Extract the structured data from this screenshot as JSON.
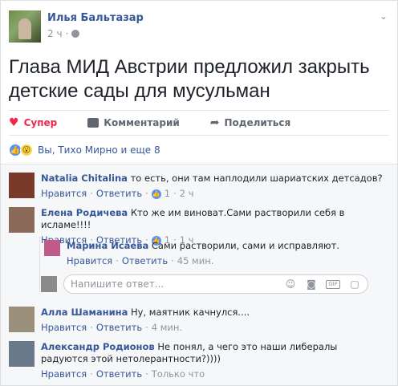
{
  "post": {
    "author": "Илья Бальтазар",
    "time": "2 ч",
    "text": "Глава МИД Австрии предложил закрыть детские сады для мусульман",
    "actions": {
      "react": "Супер",
      "comment": "Комментарий",
      "share": "Поделиться"
    },
    "reactions_text": "Вы, Тихо Мирно и еще 8"
  },
  "comments": [
    {
      "name": "Natalia Chitalina",
      "text": "то есть, они там наплодили шариатских детсадов?",
      "like": "Нравится",
      "reply": "Ответить",
      "likes": "1",
      "time": "2 ч",
      "avatar_color": "#7a3a2a"
    },
    {
      "name": "Елена Родичева",
      "text": "Кто же им виноват.Сами растворили себя в исламе!!!!",
      "like": "Нравится",
      "reply": "Ответить",
      "likes": "1",
      "time": "1 ч",
      "avatar_color": "#8b6a5a"
    },
    {
      "name": "Алла Шаманина",
      "text": "Ну, маятник качнулся....",
      "like": "Нравится",
      "reply": "Ответить",
      "time": "4 мин.",
      "avatar_color": "#9a8f7a"
    },
    {
      "name": "Александр Родионов",
      "text": "Не понял, а чего это наши либералы радуются этой нетолерантности?))))",
      "like": "Нравится",
      "reply": "Ответить",
      "time": "Только что",
      "avatar_color": "#6b7a8a"
    }
  ],
  "reply": {
    "name": "Марина Исаева",
    "text": "Сами растворили, сами и исправляют.",
    "like": "Нравится",
    "reply": "Ответить",
    "time": "45 мин.",
    "avatar_color": "#c05a8a"
  },
  "reply_input": {
    "placeholder": "Напишите ответ..."
  },
  "colors": {
    "link": "#365899",
    "super": "#f0284a",
    "like_blue": "#5890ff"
  }
}
